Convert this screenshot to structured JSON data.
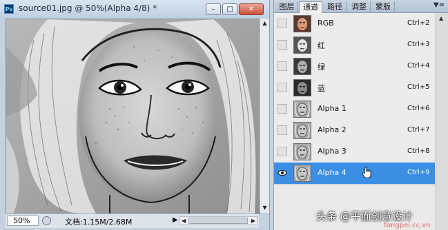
{
  "document": {
    "app_badge": "Ps",
    "title": "source01.jpg @ 50%(Alpha 4/8) *",
    "window_buttons": {
      "minimize": "–",
      "maximize": "□",
      "close": "✕"
    },
    "zoom_value": "50%",
    "doc_info": "文档:1.15M/2.68M",
    "status_arrow": "▶"
  },
  "panel": {
    "tabs": [
      {
        "label": "图层",
        "active": false
      },
      {
        "label": "通道",
        "active": true
      },
      {
        "label": "路径",
        "active": false
      },
      {
        "label": "调整",
        "active": false
      },
      {
        "label": "蒙版",
        "active": false
      }
    ],
    "menu_glyph": "▼≡",
    "channels": [
      {
        "name": "RGB",
        "shortcut": "Ctrl+2",
        "thumb": "color",
        "visible": false,
        "selected": false
      },
      {
        "name": "红",
        "shortcut": "Ctrl+3",
        "thumb": "gray-light",
        "visible": false,
        "selected": false
      },
      {
        "name": "绿",
        "shortcut": "Ctrl+4",
        "thumb": "gray",
        "visible": false,
        "selected": false
      },
      {
        "name": "蓝",
        "shortcut": "Ctrl+5",
        "thumb": "gray-dark",
        "visible": false,
        "selected": false
      },
      {
        "name": "Alpha 1",
        "shortcut": "Ctrl+6",
        "thumb": "sketch",
        "visible": false,
        "selected": false
      },
      {
        "name": "Alpha 2",
        "shortcut": "Ctrl+7",
        "thumb": "sketch",
        "visible": false,
        "selected": false
      },
      {
        "name": "Alpha 3",
        "shortcut": "Ctrl+8",
        "thumb": "sketch",
        "visible": false,
        "selected": false
      },
      {
        "name": "Alpha 4",
        "shortcut": "Ctrl+9",
        "thumb": "sketch",
        "visible": true,
        "selected": true
      }
    ]
  },
  "watermark": {
    "text": "头条 @平面创意设计",
    "sub": "tongpei.cc.vn"
  },
  "colors": {
    "selected_row": "#3a8ee6",
    "titlebar": "#c9d6e4"
  }
}
